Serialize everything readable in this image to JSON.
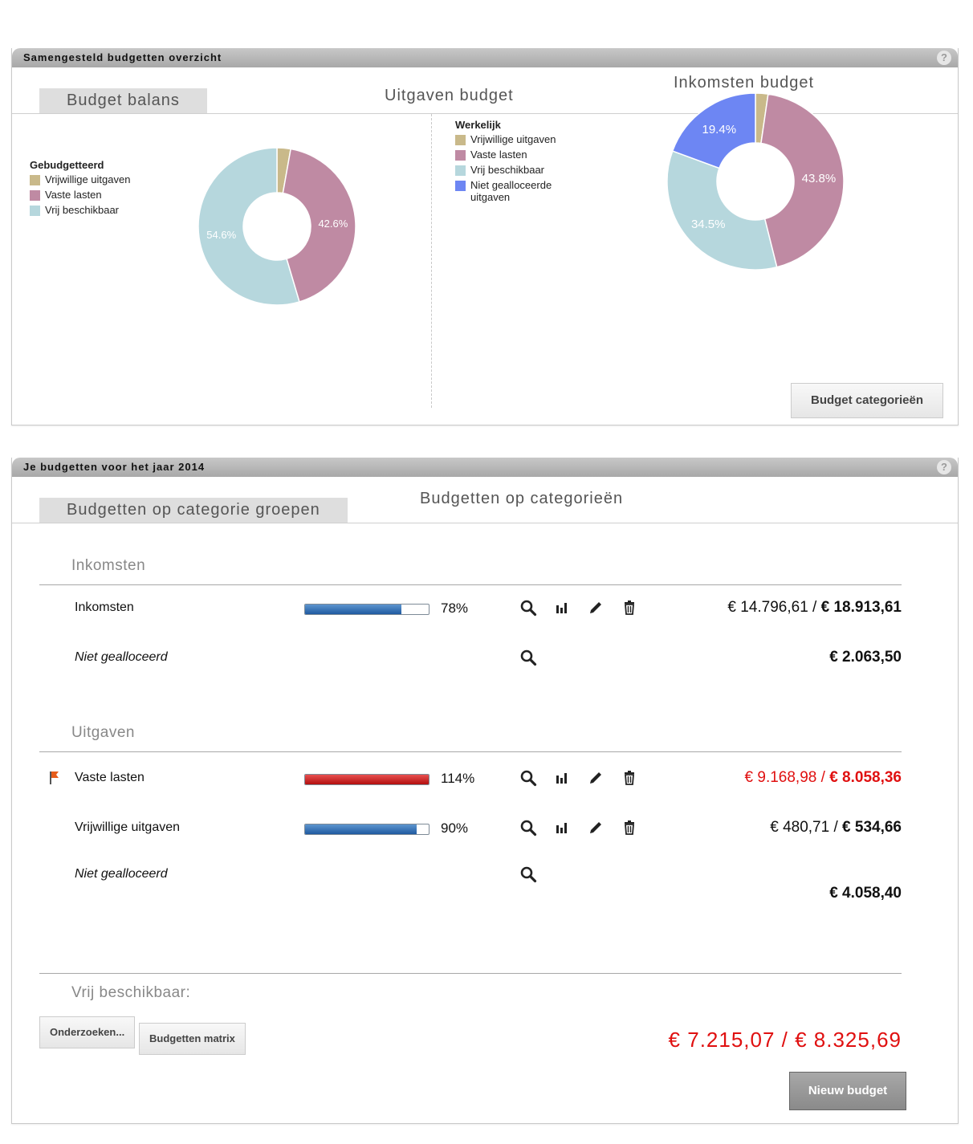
{
  "overview": {
    "title": "Samengesteld budgetten overzicht",
    "help": "?",
    "tabs": [
      "Budget balans",
      "Uitgaven budget",
      "Inkomsten budget"
    ],
    "left_legend": {
      "title": "Gebudgetteerd",
      "items": [
        "Vrijwillige uitgaven",
        "Vaste lasten",
        "Vrij beschikbaar"
      ]
    },
    "right_legend": {
      "title": "Werkelijk",
      "items": [
        "Vrijwillige uitgaven",
        "Vaste lasten",
        "Vrij beschikbaar",
        "Niet gealloceerde uitgaven"
      ]
    },
    "budget_categories_button": "Budget categorieën"
  },
  "chart_data": [
    {
      "type": "pie",
      "variant": "donut",
      "legend_title": "Gebudgetteerd",
      "labels": [
        "Vrijwillige uitgaven",
        "Vaste lasten",
        "Vrij beschikbaar"
      ],
      "values": [
        2.8,
        42.6,
        54.6
      ],
      "value_labels": [
        "",
        "42.6%",
        "54.6%"
      ],
      "colors": [
        "#c9b98a",
        "#bf8aa3",
        "#b6d7dd"
      ]
    },
    {
      "type": "pie",
      "variant": "donut",
      "legend_title": "Werkelijk",
      "labels": [
        "Vrijwillige uitgaven",
        "Vaste lasten",
        "Vrij beschikbaar",
        "Niet gealloceerde uitgaven"
      ],
      "values": [
        2.3,
        43.8,
        34.5,
        19.4
      ],
      "value_labels": [
        "",
        "43.8%",
        "34.5%",
        "19.4%"
      ],
      "colors": [
        "#c9b98a",
        "#bf8aa3",
        "#b6d7dd",
        "#6d86f3"
      ]
    }
  ],
  "budgets": {
    "title": "Je budgetten voor het jaar 2014",
    "help": "?",
    "tabs": [
      "Budgetten op categorie groepen",
      "Budgetten op categorieën"
    ],
    "inkomsten": {
      "title": "Inkomsten",
      "rows": [
        {
          "label": "Inkomsten",
          "progress": 0.78,
          "pct": "78%",
          "actual": "€ 14.796,61",
          "sep": " / ",
          "budget": "€ 18.913,61"
        },
        {
          "label": "Niet gealloceerd",
          "amount": "€ 2.063,50"
        }
      ]
    },
    "uitgaven": {
      "title": "Uitgaven",
      "rows": [
        {
          "label": "Vaste lasten",
          "progress": 1.14,
          "pct": "114%",
          "actual": "€ 9.168,98",
          "sep": " / ",
          "budget": "€ 8.058,36",
          "flag_color": "#e65c1a"
        },
        {
          "label": "Vrijwillige uitgaven",
          "progress": 0.9,
          "pct": "90%",
          "actual": "€ 480,71",
          "sep": " / ",
          "budget": "€ 534,66"
        },
        {
          "label": "Niet gealloceerd",
          "amount": "€ 4.058,40"
        }
      ]
    },
    "vrij": {
      "label": "Vrij beschikbaar:",
      "total": "€ 7.215,07 / € 8.325,69"
    },
    "buttons": {
      "onderzoeken": "Onderzoeken...",
      "matrix": "Budgetten matrix",
      "nieuw": "Nieuw budget"
    },
    "colors": {
      "over_budget": "#e01010",
      "progress_blue": "#1f5aa0",
      "progress_red": "#b30f0f"
    }
  }
}
